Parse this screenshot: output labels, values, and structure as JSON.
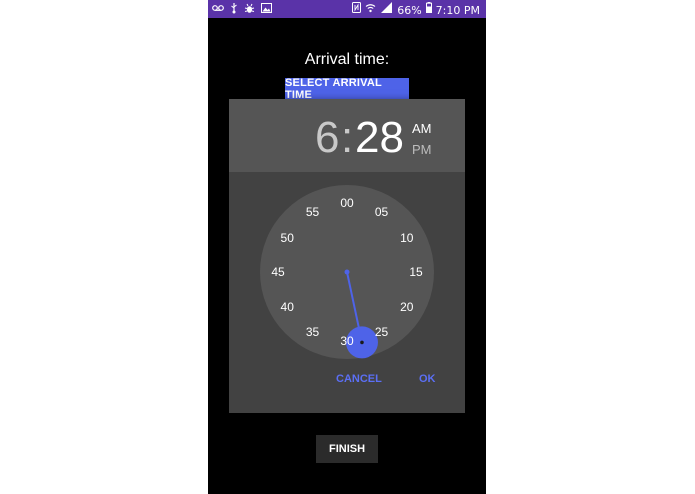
{
  "status_bar": {
    "left_icons": [
      "voicemail-icon",
      "usb-icon",
      "bug-icon",
      "image-icon"
    ],
    "battery_percent": "66%",
    "time": "7:10 PM"
  },
  "screen": {
    "title": "Arrival time:",
    "select_button_label": "SELECT ARRIVAL TIME",
    "finish_button_label": "FINISH"
  },
  "time_picker": {
    "hour": "6",
    "separator": ":",
    "minute": "28",
    "am_label": "AM",
    "pm_label": "PM",
    "selected_period": "AM",
    "selected_minute_value": 28,
    "minute_labels": [
      "00",
      "05",
      "10",
      "15",
      "20",
      "25",
      "30",
      "35",
      "40",
      "45",
      "50",
      "55"
    ],
    "cancel_label": "CANCEL",
    "ok_label": "OK",
    "accent_color": "#4e63e8"
  }
}
